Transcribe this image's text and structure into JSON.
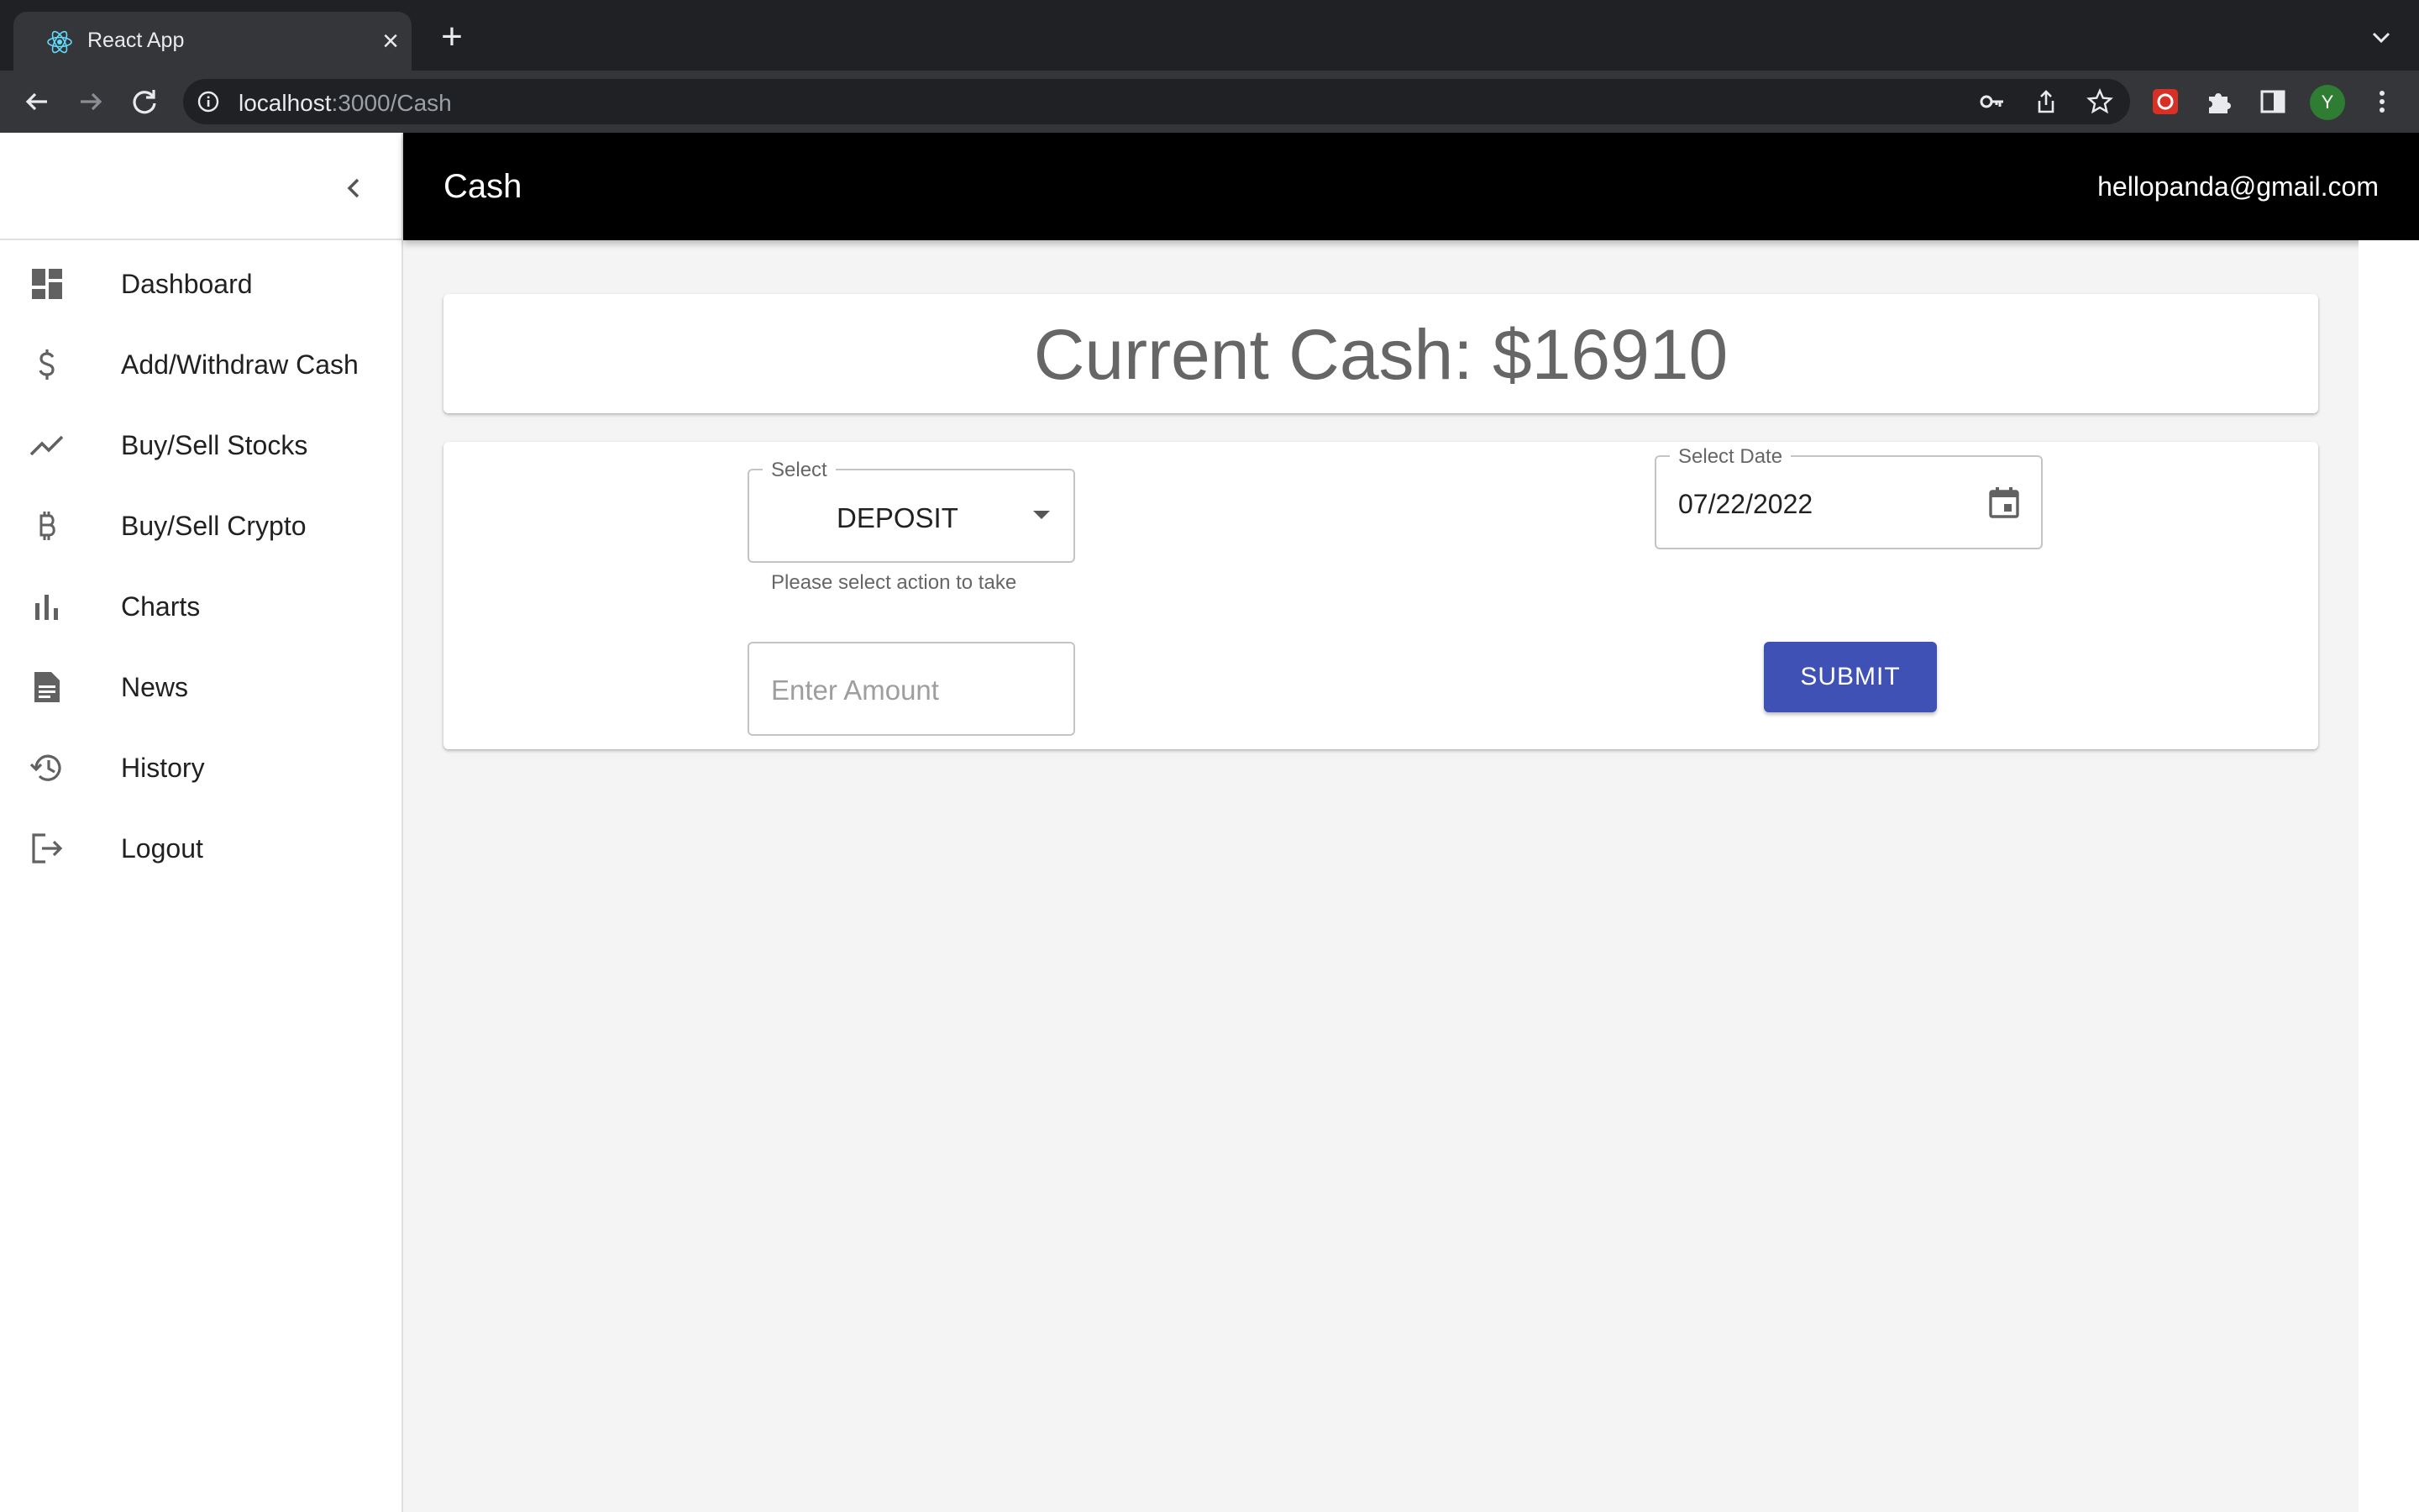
{
  "browser": {
    "tab_title": "React App",
    "url_host": "localhost",
    "url_path": ":3000/Cash",
    "profile_initial": "Y"
  },
  "header": {
    "title": "Cash",
    "user_email": "hellopanda@gmail.com"
  },
  "sidebar": {
    "items": [
      {
        "label": "Dashboard",
        "icon": "dashboard-icon"
      },
      {
        "label": "Add/Withdraw Cash",
        "icon": "dollar-icon"
      },
      {
        "label": "Buy/Sell Stocks",
        "icon": "trending-up-icon"
      },
      {
        "label": "Buy/Sell Crypto",
        "icon": "bitcoin-icon"
      },
      {
        "label": "Charts",
        "icon": "bar-chart-icon"
      },
      {
        "label": "News",
        "icon": "article-icon"
      },
      {
        "label": "History",
        "icon": "history-icon"
      },
      {
        "label": "Logout",
        "icon": "logout-icon"
      }
    ]
  },
  "cash": {
    "text": "Current Cash: $16910"
  },
  "form": {
    "select_label": "Select",
    "select_value": "DEPOSIT",
    "select_helper": "Please select action to take",
    "amount_placeholder": "Enter Amount",
    "date_label": "Select Date",
    "date_value": "07/22/2022",
    "submit_label": "SUBMIT"
  },
  "colors": {
    "appbar": "#000000",
    "primary_button": "#3f51b5",
    "background": "#f4f4f4"
  }
}
